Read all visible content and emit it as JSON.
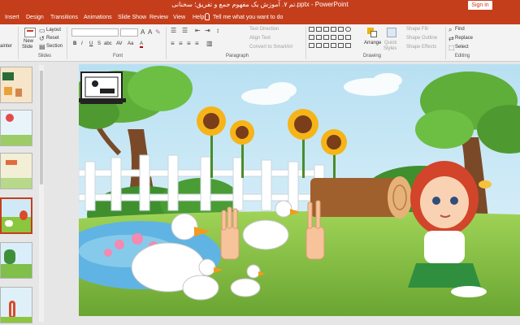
{
  "app": {
    "title": "تم ۷. آموزش یک مفهوم جمع و تفریق؛ سخنانی.pptx - PowerPoint",
    "signin": "Sign in",
    "tell_me": "Tell me what you want to do"
  },
  "tabs": [
    "Insert",
    "Design",
    "Transitions",
    "Animations",
    "Slide Show",
    "Review",
    "View",
    "Help"
  ],
  "ribbon": {
    "clipboard": {
      "painter": "ainter"
    },
    "slides": {
      "new_slide": "New",
      "new_slide2": "Slide",
      "layout": "Layout",
      "reset": "Reset",
      "section": "Section",
      "label": "Slides"
    },
    "font": {
      "label": "Font",
      "bold": "B",
      "italic": "I",
      "underline": "U",
      "strike": "S",
      "shadow": "abc",
      "spacing": "AV",
      "case": "Aa",
      "color": "A"
    },
    "paragraph": {
      "label": "Paragraph",
      "text_direction": "Text Direction",
      "align_text": "Align Text",
      "smartart": "Convert to SmartArt"
    },
    "drawing": {
      "label": "Drawing",
      "arrange": "Arrange",
      "quick_styles": "Quick",
      "quick_styles2": "Styles",
      "shape_fill": "Shape Fill",
      "shape_outline": "Shape Outline",
      "shape_effects": "Shape Effects"
    },
    "editing": {
      "label": "Editing",
      "find": "Find",
      "replace": "Replace",
      "select": "Select"
    }
  },
  "thumbnails": [
    {
      "number": "",
      "active": false
    },
    {
      "number": "",
      "active": false
    },
    {
      "number": "",
      "active": false
    },
    {
      "number": "",
      "active": true
    },
    {
      "number": "",
      "active": false
    },
    {
      "number": "",
      "active": false
    }
  ],
  "colors": {
    "accent": "#c43e1c",
    "ribbon_bg": "#f3f3f3",
    "sky": "#cfeaf6",
    "grass": "#8cc63f",
    "pond": "#5fb4e3"
  }
}
